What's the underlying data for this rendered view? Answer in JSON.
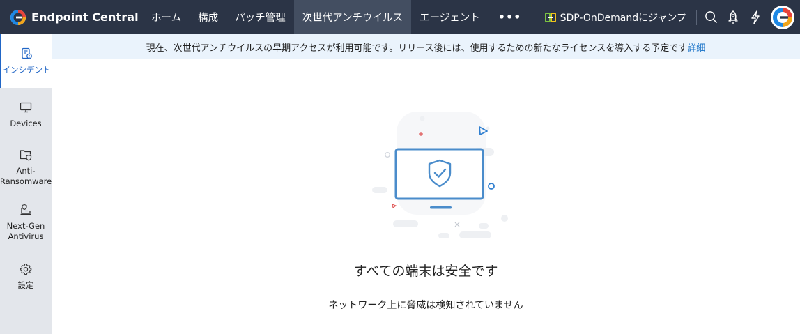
{
  "brand": {
    "name": "Endpoint Central"
  },
  "nav": {
    "items": [
      {
        "label": "ホーム",
        "active": false
      },
      {
        "label": "構成",
        "active": false
      },
      {
        "label": "パッチ管理",
        "active": false
      },
      {
        "label": "次世代アンチウイルス",
        "active": true
      },
      {
        "label": "エージェント",
        "active": false
      }
    ],
    "more_label": "•••"
  },
  "topbar_right": {
    "jump_label": "SDP-OnDemandにジャンプ",
    "icons": [
      "search-icon",
      "rocket-icon",
      "lightning-icon"
    ]
  },
  "sidebar": {
    "items": [
      {
        "label": "インシデント",
        "icon": "incident-icon",
        "active": true
      },
      {
        "label": "Devices",
        "icon": "monitor-icon",
        "active": false
      },
      {
        "label": "Anti-Ransomware",
        "icon": "folder-shield-icon",
        "active": false
      },
      {
        "label": "Next-Gen Antivirus",
        "icon": "antivirus-icon",
        "active": false
      },
      {
        "label": "設定",
        "icon": "gear-icon",
        "active": false
      }
    ]
  },
  "banner": {
    "text": "現在、次世代アンチウイルスの早期アクセスが利用可能です。リリース後には、使用するための新たなライセンスを導入する予定です",
    "link_label": "詳細"
  },
  "main": {
    "title": "すべての端末は安全です",
    "subtitle": "ネットワーク上に脅威は検知されていません",
    "illustration": "monitor-shield-check-icon"
  },
  "colors": {
    "topbar": "#2b3446",
    "nav_active": "#434e61",
    "sidebar": "#e3e6eb",
    "banner": "#eaf3fc",
    "accent": "#2166c6",
    "link": "#1a73c8",
    "illustration_blue": "#4a8ccb"
  }
}
